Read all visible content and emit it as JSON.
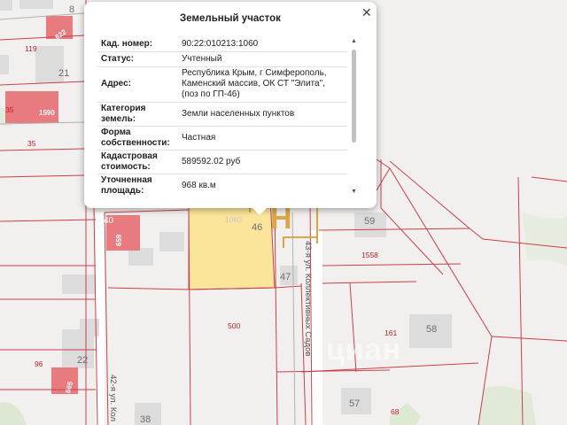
{
  "popup": {
    "title": "Земельный участок",
    "close_icon": "close-icon",
    "rows": [
      {
        "label": "Кад. номер:",
        "value": "90:22:010213:1060"
      },
      {
        "label": "Статус:",
        "value": "Учтенный"
      },
      {
        "label": "Адрес:",
        "value": "Республика Крым, г Симферополь, Каменский массив, ОК СТ \"Элита\", (поз по ГП-46)"
      },
      {
        "label": "Категория земель:",
        "value": "Земли населенных пунктов"
      },
      {
        "label": "Форма собственности:",
        "value": "Частная"
      },
      {
        "label": "Кадастровая стоимость:",
        "value": "589592.02 руб"
      },
      {
        "label": "Уточненная площадь:",
        "value": "968 кв.м"
      }
    ]
  },
  "map": {
    "house_numbers": [
      "8",
      "21",
      "59",
      "46",
      "47",
      "58",
      "22",
      "57",
      "38"
    ],
    "parcel_numbers": [
      "119",
      "35",
      "35",
      "500",
      "1558",
      "161",
      "96",
      "68",
      "1060",
      "40"
    ],
    "rotated_labels": [
      "622",
      "1590",
      "659",
      "665"
    ],
    "streets": [
      "43-я ул. Коллективных Садов",
      "42-я ул. Кол"
    ],
    "watermark": "циан",
    "marker_icon": "hotel-h-icon",
    "colors": {
      "highlight_fill": "#fbe59a",
      "parcel_line": "#c8414b",
      "building_red": "#e77b80",
      "marker": "#d9a64a"
    }
  }
}
